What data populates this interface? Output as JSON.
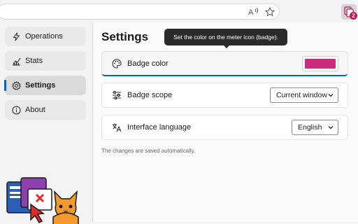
{
  "browser": {
    "read_aloud_icon": "read-aloud-icon",
    "favorite_icon": "star-icon",
    "extension_badge": "2",
    "badge_color": "#c2185b"
  },
  "sidebar": {
    "items": [
      {
        "label": "Operations",
        "icon": "bolt-icon"
      },
      {
        "label": "Stats",
        "icon": "chart-icon"
      },
      {
        "label": "Settings",
        "icon": "gear-icon",
        "active": true
      },
      {
        "label": "About",
        "icon": "info-icon"
      }
    ]
  },
  "main": {
    "title": "Settings",
    "tooltip": "Set the color on the meter icon (badge).",
    "settings": [
      {
        "label": "Badge color",
        "icon": "palette-icon",
        "value": "#cc2a7d"
      },
      {
        "label": "Badge scope",
        "icon": "sliders-icon",
        "value": "Current window"
      },
      {
        "label": "Interface language",
        "icon": "translate-icon",
        "value": "English"
      }
    ],
    "hint": "The changes are saved automatically."
  },
  "colors": {
    "accent": "#0067c0",
    "swatch": "#cc2a7d"
  }
}
